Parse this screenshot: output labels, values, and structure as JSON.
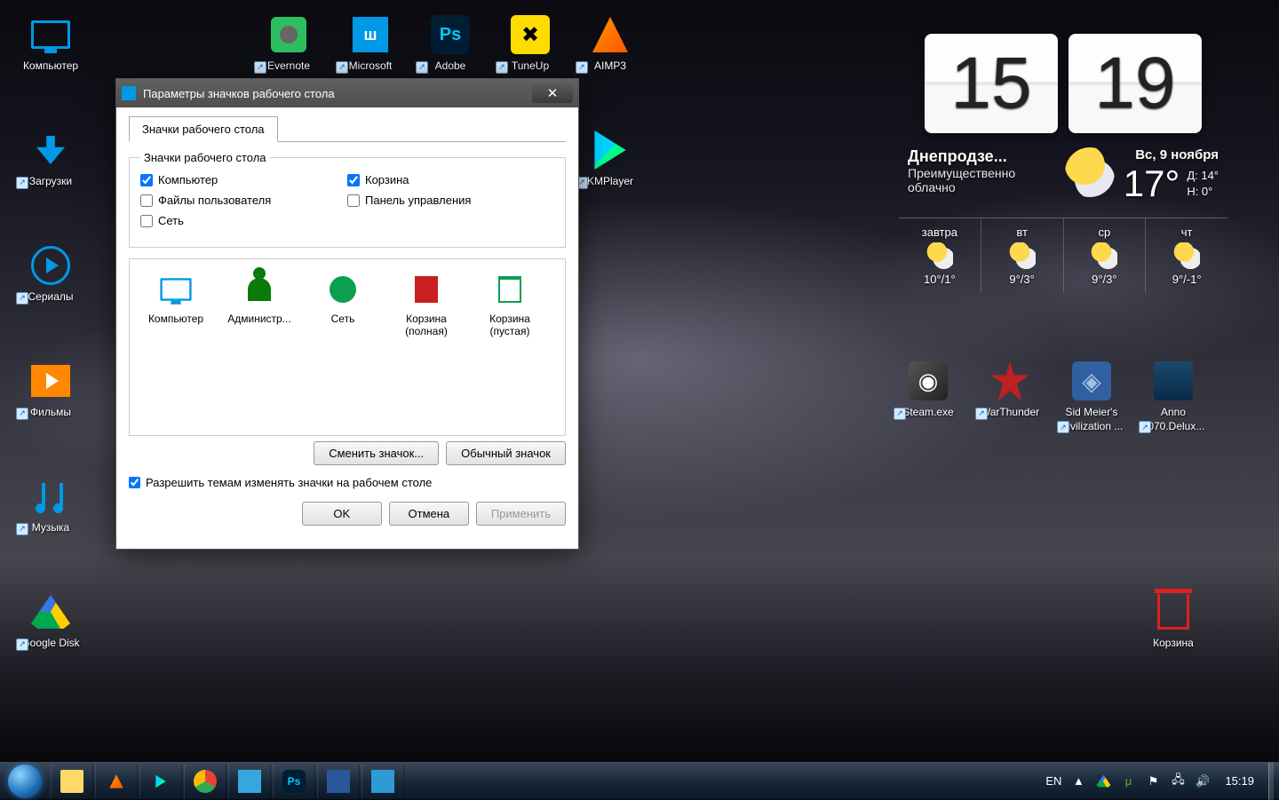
{
  "desktop": {
    "icons": [
      {
        "label": "Компьютер",
        "name": "computer"
      },
      {
        "label": "Загрузки",
        "name": "downloads"
      },
      {
        "label": "Сериалы",
        "name": "serials"
      },
      {
        "label": "Фильмы",
        "name": "films"
      },
      {
        "label": "Музыка",
        "name": "music"
      },
      {
        "label": "Google Disk",
        "name": "gdisk"
      },
      {
        "label": "Evernote",
        "name": "evernote"
      },
      {
        "label": "Microsoft",
        "name": "microsoft"
      },
      {
        "label": "Adobe",
        "name": "adobe"
      },
      {
        "label": "TuneUp",
        "name": "tuneup"
      },
      {
        "label": "AIMP3",
        "name": "aimp3"
      },
      {
        "label": "KMPlayer",
        "name": "kmplayer"
      },
      {
        "label": "Steam.exe",
        "name": "steam"
      },
      {
        "label": "WarThunder",
        "name": "warthunder"
      },
      {
        "label": "Sid Meier's Civilization ...",
        "name": "civ"
      },
      {
        "label": "Anno 2070.Delux...",
        "name": "anno"
      },
      {
        "label": "Корзина",
        "name": "recycle"
      }
    ]
  },
  "widget": {
    "hours": "15",
    "minutes": "19",
    "city": "Днепродзе...",
    "condition": "Преимущественно облачно",
    "date": "Вс, 9 ноября",
    "temp": "17°",
    "high": "Д: 14°",
    "low": "Н: 0°",
    "forecast": [
      {
        "day": "завтра",
        "t": "10°/1°"
      },
      {
        "day": "вт",
        "t": "9°/3°"
      },
      {
        "day": "ср",
        "t": "9°/3°"
      },
      {
        "day": "чт",
        "t": "9°/-1°"
      }
    ]
  },
  "dialog": {
    "title": "Параметры значков рабочего стола",
    "tab": "Значки рабочего стола",
    "legend": "Значки рабочего стола",
    "cb": {
      "computer": "Компьютер",
      "recycle": "Корзина",
      "userfiles": "Файлы пользователя",
      "cpanel": "Панель управления",
      "network": "Сеть"
    },
    "iconlist": [
      {
        "label": "Компьютер"
      },
      {
        "label": "Администр..."
      },
      {
        "label": "Сеть"
      },
      {
        "label": "Корзина (полная)"
      },
      {
        "label": "Корзина (пустая)"
      }
    ],
    "btn": {
      "change": "Сменить значок...",
      "default": "Обычный значок",
      "ok": "OK",
      "cancel": "Отмена",
      "apply": "Применить"
    },
    "permit": "Разрешить темам изменять значки на рабочем столе"
  },
  "taskbar": {
    "lang": "EN",
    "clock": "15:19"
  }
}
